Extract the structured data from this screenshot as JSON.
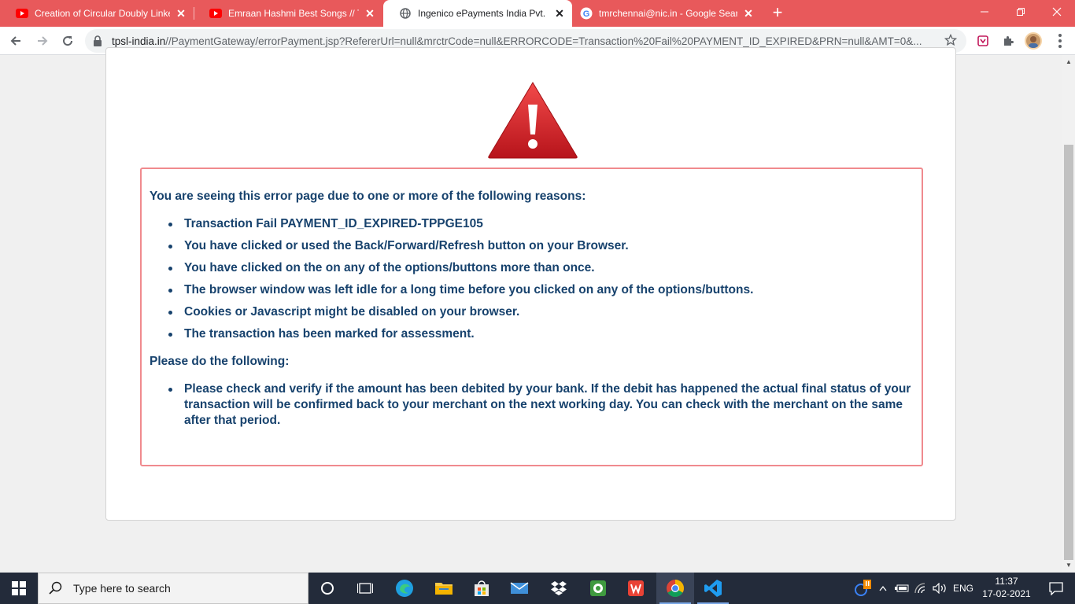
{
  "browser": {
    "tabs": [
      {
        "title": "Creation of Circular Doubly Linke",
        "favicon": "youtube-icon",
        "active": false
      },
      {
        "title": "Emraan Hashmi Best Songs // To",
        "favicon": "youtube-icon",
        "active": false
      },
      {
        "title": "Ingenico ePayments India Pvt. Ltd",
        "favicon": "globe-icon",
        "active": true
      },
      {
        "title": "tmrchennai@nic.in - Google Sear",
        "favicon": "google-icon",
        "active": false
      }
    ],
    "new_tab": "+",
    "address": {
      "host": "tpsl-india.in",
      "path": "//PaymentGateway/errorPayment.jsp?RefererUrl=null&mrctrCode=null&ERRORCODE=Transaction%20Fail%20PAYMENT_ID_EXPIRED&PRN=null&AMT=0&..."
    },
    "colors": {
      "tabstrip": "#e8595b",
      "toolbar": "#ffffff"
    }
  },
  "page": {
    "heading": "You are seeing this error page due to one or more of the following reasons:",
    "reasons": [
      "Transaction Fail PAYMENT_ID_EXPIRED-TPPGE105",
      "You have clicked or used the Back/Forward/Refresh button on your Browser.",
      "You have clicked on the on any of the options/buttons more than once.",
      "The browser window was left idle for a long time before you clicked on any of the options/buttons.",
      "Cookies or Javascript might be disabled on your browser.",
      "The transaction has been marked for assessment."
    ],
    "follow_heading": "Please do the following:",
    "follow_items": [
      "Please check and verify if the amount has been debited by your bank. If the debit has happened the actual final status of your transaction will be confirmed back to your merchant on the next working day. You can check with the merchant on the same after that period."
    ],
    "colors": {
      "text": "#17426d",
      "border": "#f08a8e",
      "warning": "#d32027"
    }
  },
  "taskbar": {
    "search_placeholder": "Type here to search",
    "language": "ENG",
    "time": "11:37",
    "date": "17-02-2021"
  }
}
